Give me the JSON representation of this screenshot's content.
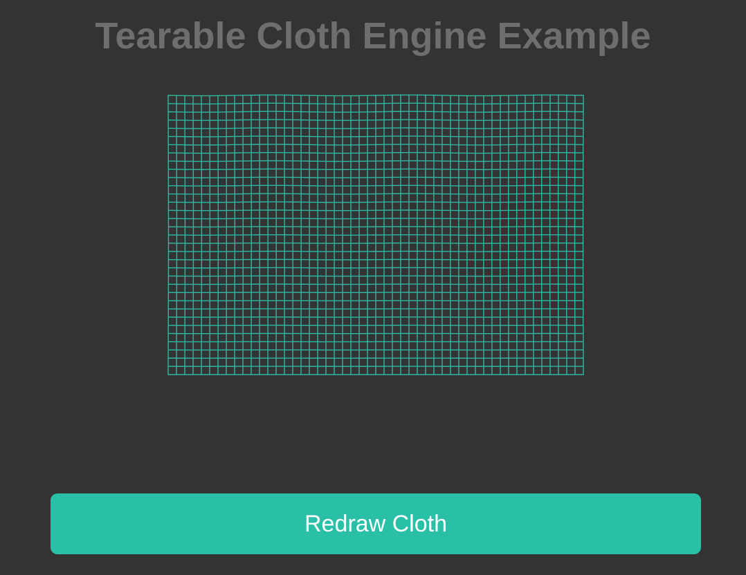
{
  "page": {
    "title": "Tearable Cloth Engine Example"
  },
  "cloth": {
    "columns": 50,
    "rows": 34,
    "line_color": "#2db9a2",
    "background_color": "#333333"
  },
  "controls": {
    "redraw_label": "Redraw Cloth",
    "button_color": "#2abfa7"
  }
}
